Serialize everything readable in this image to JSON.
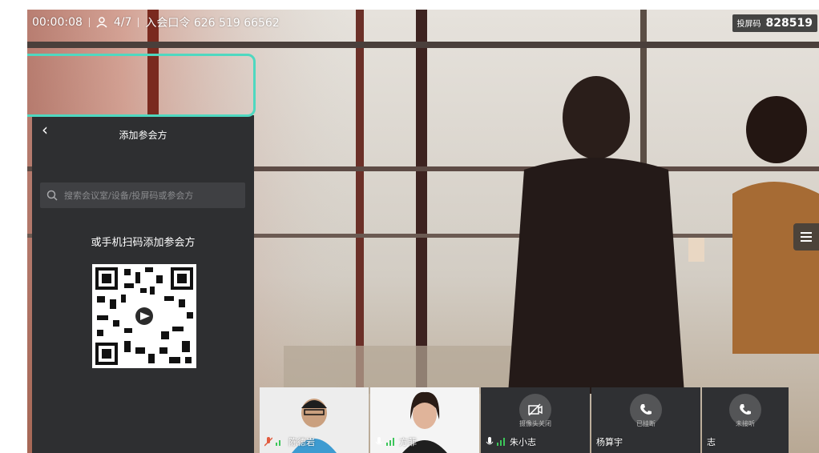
{
  "topbar": {
    "timer": "00:00:08",
    "participants": "4/7",
    "meeting_code_label": "入会口令 626 519 66562"
  },
  "screen_code": {
    "label": "投屏码",
    "value": "828519"
  },
  "panel": {
    "title": "添加参会方",
    "search_placeholder": "搜索会议室/设备/投屏码或参会方",
    "scan_title": "或手机扫码添加参会方"
  },
  "thumbnails": [
    {
      "name": "陈德岩",
      "status": ""
    },
    {
      "name": "方菲",
      "status": ""
    },
    {
      "name": "朱小志",
      "status": "摄像头关闭"
    },
    {
      "name": "杨算宇",
      "status": "已挂断"
    },
    {
      "name": "志",
      "status": "未接听"
    }
  ],
  "colors": {
    "highlight": "#4fd8c0",
    "panel_bg": "#2e2f31",
    "signal": "#3cc65a"
  },
  "icons": [
    "back-icon",
    "user-icon",
    "search-icon",
    "menu-icon",
    "mic-icon",
    "signal-icon",
    "camera-off-icon",
    "phone-icon"
  ]
}
